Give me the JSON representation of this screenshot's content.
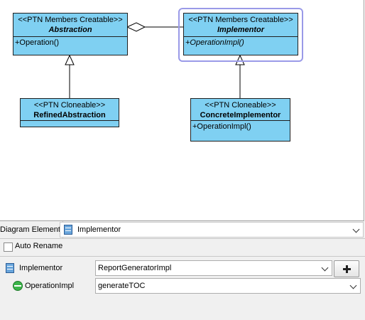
{
  "diagram": {
    "abstraction": {
      "stereotype": "<<PTN Members Creatable>>",
      "name": "Abstraction",
      "operation": "+Operation()"
    },
    "implementor": {
      "stereotype": "<<PTN Members Creatable>>",
      "name": "Implementor",
      "operation": "+OperationImpl()"
    },
    "refined_abstraction": {
      "stereotype": "<<PTN Cloneable>>",
      "name": "RefinedAbstraction"
    },
    "concrete_implementor": {
      "stereotype": "<<PTN Cloneable>>",
      "name": "ConcreteImplementor",
      "operation": "+OperationImpl()"
    }
  },
  "panel": {
    "tab_label": "Diagram Element",
    "element_select": "Implementor",
    "auto_rename_label": "Auto Rename",
    "auto_rename_checked": false,
    "rows": [
      {
        "icon": "class-icon",
        "label": "Implementor",
        "value": "ReportGeneratorImpl"
      },
      {
        "icon": "operation-icon",
        "label": "OperationImpl",
        "value": "generateTOC"
      }
    ],
    "add_button_icon": "plus-icon"
  }
}
